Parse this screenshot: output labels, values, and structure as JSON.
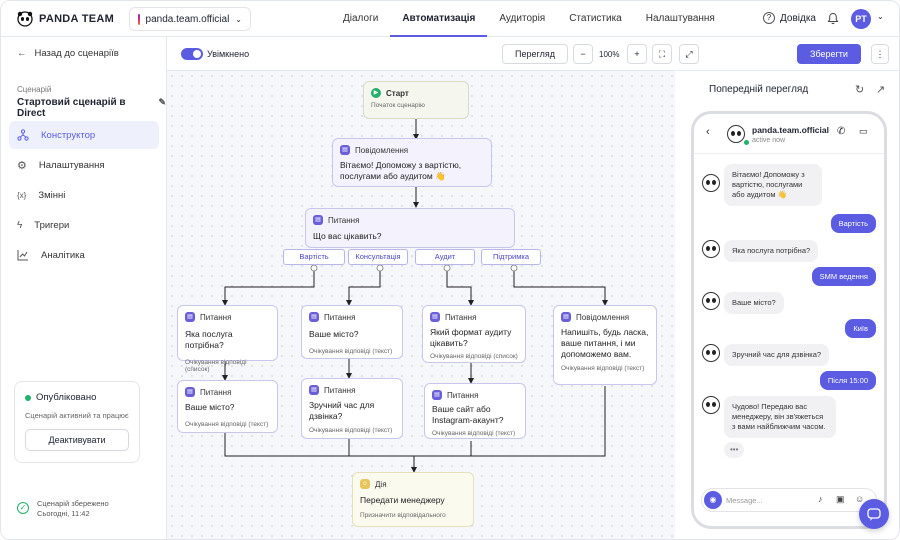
{
  "app": {
    "brand": "PANDA TEAM",
    "account": "panda.team.official"
  },
  "nav": [
    "Діалоги",
    "Автоматизація",
    "Аудиторія",
    "Статистика",
    "Налаштування"
  ],
  "nav_active": "Автоматизація",
  "header": {
    "help": "Довідка",
    "avatar": "PT"
  },
  "sidebar": {
    "back": "Назад до сценаріїв",
    "scenario_label": "Сценарій",
    "scenario_name": "Стартовий сценарій в Direct",
    "menu": [
      "Конструктор",
      "Налаштування",
      "Змінні",
      "Тригери",
      "Аналітика"
    ],
    "publish": {
      "title": "Опубліковано",
      "desc": "Сценарій активний та працює",
      "button": "Деактивувати"
    },
    "saved": {
      "line1": "Сценарій збережено",
      "line2": "Сьогодні, 11:42"
    }
  },
  "toolbar": {
    "toggle_label": "Увімкнено",
    "preview": "Перегляд",
    "zoom": "100%",
    "save": "Зберегти"
  },
  "flow": {
    "start": {
      "title": "Старт",
      "sub": "Початок сценарію"
    },
    "message1": {
      "title": "Повідомлення",
      "text": "Вітаємо! Допоможу з вартістю, послугами або аудитом 👋"
    },
    "question1": {
      "title": "Питання",
      "text": "Що вас цікавить?"
    },
    "options": [
      "Вартість",
      "Консультація",
      "Аудит",
      "Підтримка"
    ],
    "q_price": {
      "title": "Питання",
      "text": "Яка послуга потрібна?",
      "sub": "Очікування відповіді (список)"
    },
    "q_price_city": {
      "title": "Питання",
      "text": "Ваше місто?",
      "sub": "Очікування відповіді (текст)"
    },
    "q_consult_city": {
      "title": "Питання",
      "text": "Ваше місто?",
      "sub": "Очікування відповіді (текст)"
    },
    "q_consult_time": {
      "title": "Питання",
      "text": "Зручний час для дзвінка?",
      "sub": "Очікування відповіді (текст)"
    },
    "q_audit_format": {
      "title": "Питання",
      "text": "Який формат аудиту цікавить?",
      "sub": "Очікування відповіді (список)"
    },
    "q_audit_site": {
      "title": "Питання",
      "text": "Ваше сайт або Instagram-акаунт?",
      "sub": "Очікування відповіді (текст)"
    },
    "m_support": {
      "title": "Повідомлення",
      "text": "Напишіть, будь ласка, ваше питання, і ми допоможемо вам.",
      "sub": "Очікування відповіді (текст)"
    },
    "action": {
      "title": "Дія",
      "text": "Передати менеджеру",
      "sub": "Призначити відповідального"
    }
  },
  "preview": {
    "title": "Попередній перегляд",
    "chat_name": "panda.team.official",
    "chat_status": "active now",
    "messages": [
      {
        "from": "bot",
        "text": "Вітаємо! Допоможу з вартістю, послугами або аудитом 👋"
      },
      {
        "from": "user",
        "text": "Вартість"
      },
      {
        "from": "bot",
        "text": "Яка послуга потрібна?"
      },
      {
        "from": "user",
        "text": "SMM ведення"
      },
      {
        "from": "bot",
        "text": "Ваше місто?"
      },
      {
        "from": "user",
        "text": "Київ"
      },
      {
        "from": "bot",
        "text": "Зручний час для дзвінка?"
      },
      {
        "from": "user",
        "text": "Після 15:00"
      },
      {
        "from": "bot",
        "text": "Чудово! Передаю вас менеджеру, він зв'яжеться з вами найближчим часом."
      }
    ],
    "input_placeholder": "Message..."
  },
  "colors": {
    "accent": "#5b5ce2",
    "success": "#22b06a"
  }
}
